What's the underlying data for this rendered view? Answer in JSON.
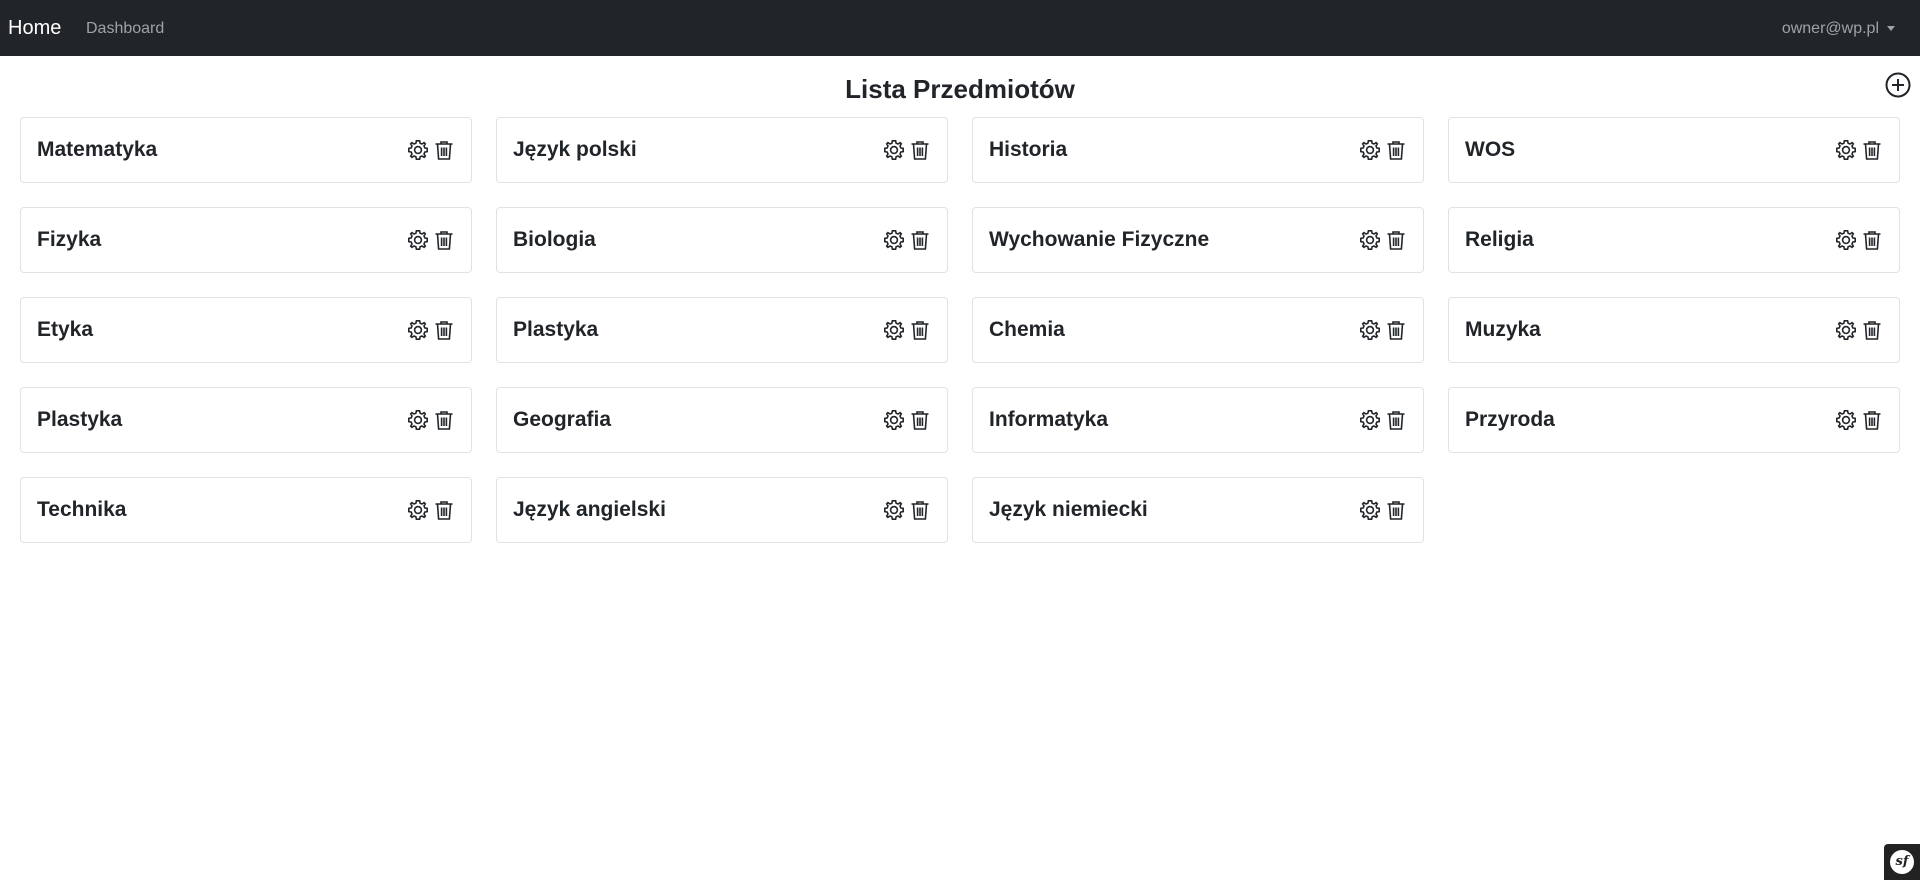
{
  "nav": {
    "brand": "Home",
    "links": [
      "Dashboard"
    ],
    "user": "owner@wp.pl"
  },
  "page": {
    "title": "Lista Przedmiotów"
  },
  "subjects": [
    "Matematyka",
    "Język polski",
    "Historia",
    "WOS",
    "Fizyka",
    "Biologia",
    "Wychowanie Fizyczne",
    "Religia",
    "Etyka",
    "Plastyka",
    "Chemia",
    "Muzyka",
    "Plastyka",
    "Geografia",
    "Informatyka",
    "Przyroda",
    "Technika",
    "Język angielski",
    "Język niemiecki"
  ],
  "icons": {
    "add": "plus-circle-icon",
    "edit": "gear-icon",
    "delete": "trash-icon",
    "toolbar": "symfony-logo-icon"
  },
  "toolbar": {
    "logo": "sf"
  }
}
